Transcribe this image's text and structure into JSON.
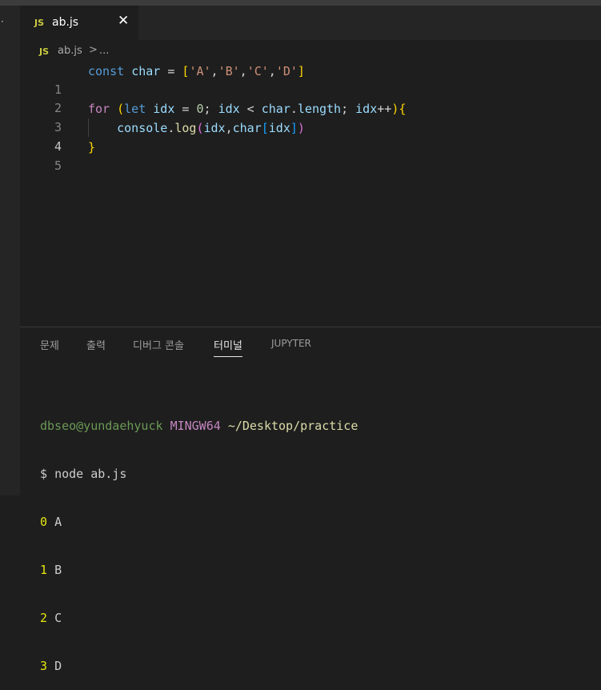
{
  "tab": {
    "badge": "JS",
    "label": "ab.js",
    "close": "✕"
  },
  "breadcrumb": {
    "badge": "JS",
    "file": "ab.js",
    "separator": ">",
    "more": "..."
  },
  "leftbar": {
    "dot": "·"
  },
  "editor": {
    "lines": [
      {
        "number": "1",
        "t": [
          "const",
          " ",
          "char",
          " = ",
          "[",
          "'A'",
          ",",
          "'B'",
          ",",
          "'C'",
          ",",
          "'D'",
          "]"
        ]
      },
      {
        "number": "2",
        "t": []
      },
      {
        "number": "3",
        "t": [
          "for",
          " ",
          "(",
          "let",
          " ",
          "idx",
          " = ",
          "0",
          "; ",
          "idx",
          " < ",
          "char",
          ".",
          "length",
          "; ",
          "idx",
          "++",
          ")",
          "{"
        ]
      },
      {
        "number": "4",
        "t": [
          "    ",
          "console",
          ".",
          "log",
          "(",
          "idx",
          ",",
          "char",
          "[",
          "idx",
          "]",
          ")"
        ]
      },
      {
        "number": "5",
        "t": [
          "}"
        ]
      }
    ]
  },
  "panel": {
    "tabs": [
      "문제",
      "출력",
      "디버그 콘솔",
      "터미널",
      "JUPYTER"
    ],
    "active_tab": "터미널"
  },
  "terminal": {
    "user": "dbseo@yundaehyuck",
    "system": "MINGW64",
    "path": "~/Desktop/practice",
    "prompt": "$",
    "command": "node ab.js",
    "output": [
      {
        "index": "0",
        "value": "A"
      },
      {
        "index": "1",
        "value": "B"
      },
      {
        "index": "2",
        "value": "C"
      },
      {
        "index": "3",
        "value": "D"
      }
    ]
  }
}
